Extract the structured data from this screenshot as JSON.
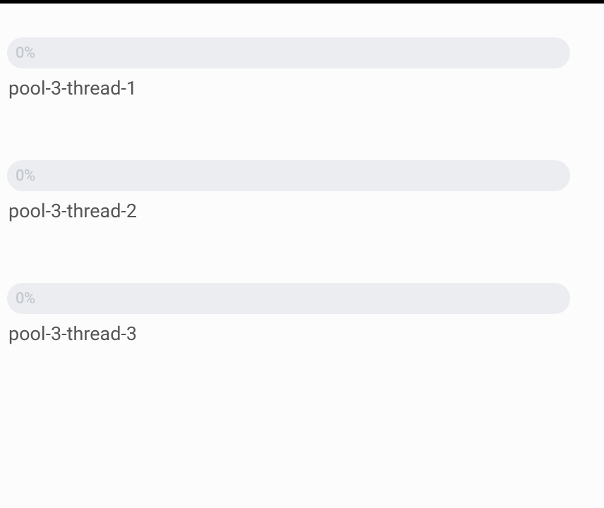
{
  "threads": [
    {
      "progress_label": "0%",
      "name": "pool-3-thread-1",
      "percent": 0
    },
    {
      "progress_label": "0%",
      "name": "pool-3-thread-2",
      "percent": 0
    },
    {
      "progress_label": "0%",
      "name": "pool-3-thread-3",
      "percent": 0
    }
  ]
}
